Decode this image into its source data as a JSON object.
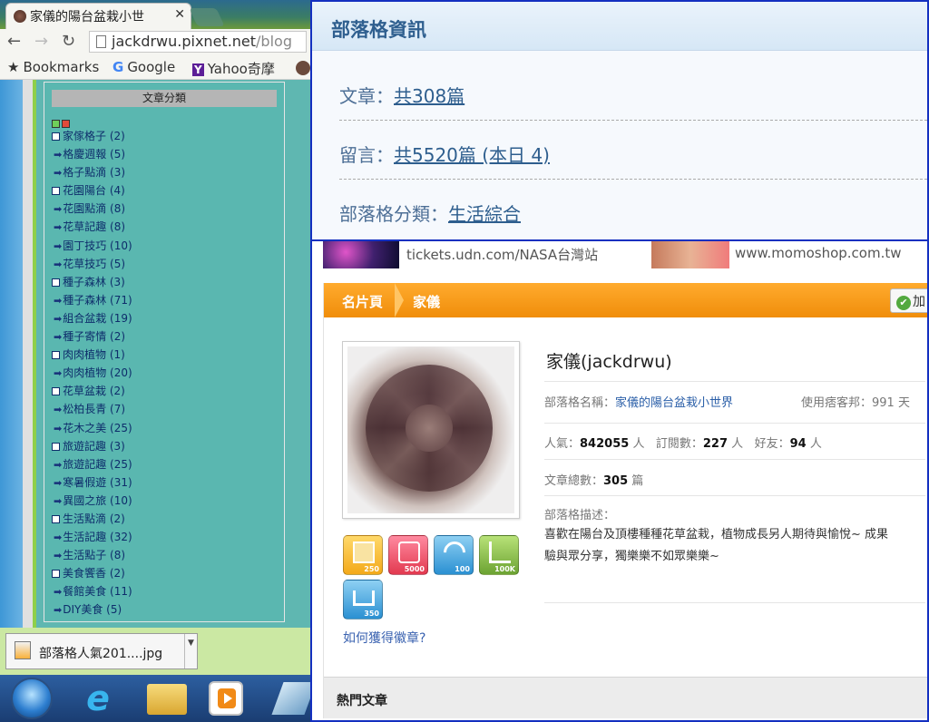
{
  "browser": {
    "tab_title": "家儀的陽台盆栽小世",
    "url_host": "jackdrwu.pixnet.net",
    "url_path": "/blog",
    "bookmarks": [
      "Bookmarks",
      "Google",
      "Yahoo奇摩"
    ]
  },
  "category_widget": {
    "title": "文章分類",
    "items": [
      {
        "label": "家傢格子 (2)",
        "level": "parent"
      },
      {
        "label": "格慶週報 (5)",
        "level": "child"
      },
      {
        "label": "格子點滴 (3)",
        "level": "child"
      },
      {
        "label": "花園陽台 (4)",
        "level": "parent"
      },
      {
        "label": "花園點滴 (8)",
        "level": "child"
      },
      {
        "label": "花草記趣 (8)",
        "level": "child"
      },
      {
        "label": "園丁技巧 (10)",
        "level": "child"
      },
      {
        "label": "花草技巧 (5)",
        "level": "child"
      },
      {
        "label": "種子森林 (3)",
        "level": "parent"
      },
      {
        "label": "種子森林 (71)",
        "level": "child"
      },
      {
        "label": "組合盆栽 (19)",
        "level": "child"
      },
      {
        "label": "種子寄情 (2)",
        "level": "child"
      },
      {
        "label": "肉肉植物 (1)",
        "level": "parent"
      },
      {
        "label": "肉肉植物 (20)",
        "level": "child"
      },
      {
        "label": "花草盆栽 (2)",
        "level": "parent"
      },
      {
        "label": "松柏長青 (7)",
        "level": "child"
      },
      {
        "label": "花木之美 (25)",
        "level": "child"
      },
      {
        "label": "旅遊記趣 (3)",
        "level": "parent"
      },
      {
        "label": "旅遊記趣 (25)",
        "level": "child"
      },
      {
        "label": "寒暑假遊 (31)",
        "level": "child"
      },
      {
        "label": "異國之旅 (10)",
        "level": "child"
      },
      {
        "label": "生活點滴 (2)",
        "level": "parent"
      },
      {
        "label": "生活記趣 (32)",
        "level": "child"
      },
      {
        "label": "生活點子 (8)",
        "level": "child"
      },
      {
        "label": "美食饗香 (2)",
        "level": "parent"
      },
      {
        "label": "餐館美食 (11)",
        "level": "child"
      },
      {
        "label": "DIY美食 (5)",
        "level": "child"
      }
    ]
  },
  "download": {
    "filename": "部落格人氣201....jpg"
  },
  "blog_info": {
    "title": "部落格資訊",
    "articles_label": "文章：",
    "articles_value": "共308篇",
    "comments_label": "留言：",
    "comments_value": "共5520篇 (本日 4)",
    "category_label": "部落格分類：",
    "category_value": "生活綜合"
  },
  "ads": [
    {
      "text": "tickets.udn.com/NASA台灣站"
    },
    {
      "text": "www.momoshop.com.tw"
    }
  ],
  "profile": {
    "bar_title": "名片頁",
    "bar_user": "家儀",
    "add_label": "加",
    "name": "家儀(jackdrwu)",
    "blog_name_label": "部落格名稱：",
    "blog_name_value": "家儀的陽台盆栽小世界",
    "days_label": "使用痞客邦：",
    "days_value": "991 天",
    "pop_label": "人氣：",
    "pop_value": "842055",
    "pop_unit": "人",
    "subs_label": "訂閱數：",
    "subs_value": "227",
    "subs_unit": "人",
    "friends_label": "好友：",
    "friends_value": "94",
    "friends_unit": "人",
    "total_label": "文章總數：",
    "total_value": "305",
    "total_unit": "篇",
    "desc_label": "部落格描述：",
    "desc_line1": "喜歡在陽台及頂樓種種花草盆栽，植物成長另人期待與愉悅~ 成果",
    "desc_line2": "驗與眾分享，獨樂樂不如眾樂樂~",
    "badges": [
      "250",
      "5000",
      "100",
      "100K",
      "350"
    ],
    "howto": "如何獲得徽章?"
  },
  "hot_title": "熱門文章"
}
